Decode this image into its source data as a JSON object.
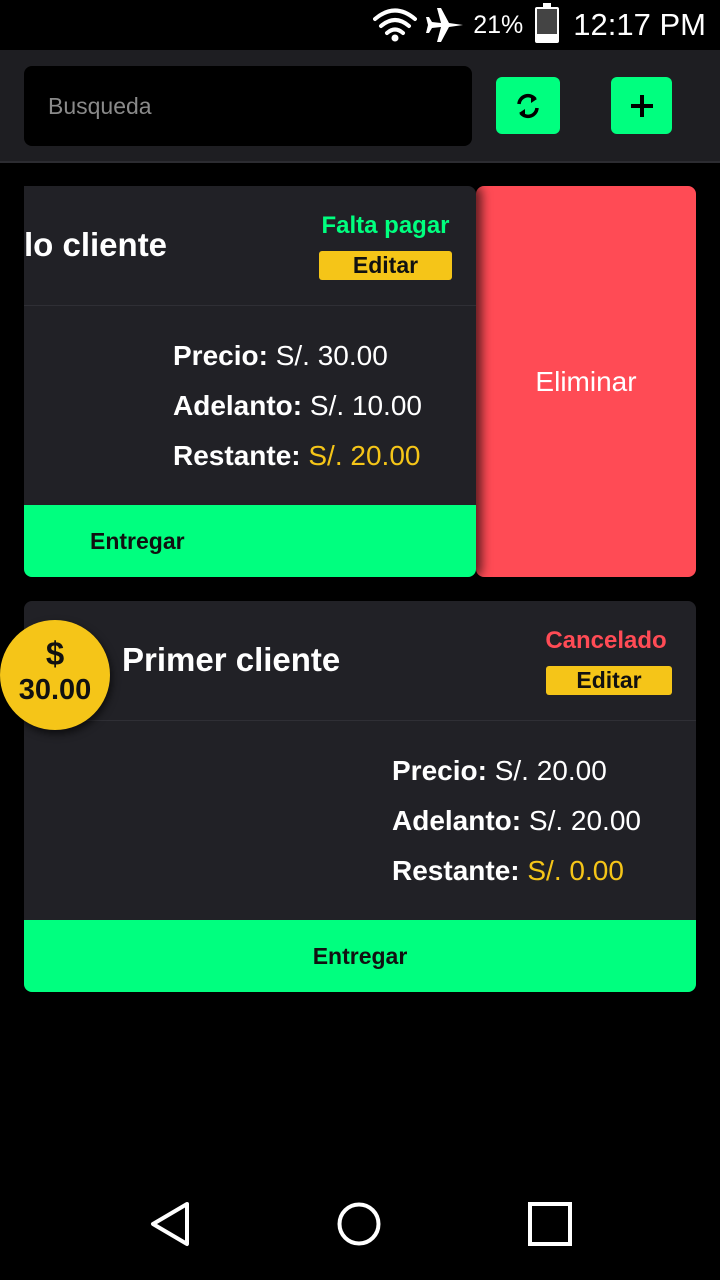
{
  "status_bar": {
    "battery": "21%",
    "battery_level": 0.21,
    "time": "12:17 PM",
    "icons": [
      "wifi-icon",
      "airplane-icon",
      "battery-icon"
    ]
  },
  "toolbar": {
    "search_placeholder": "Busqueda",
    "search_value": "",
    "refresh_icon": "refresh-icon",
    "add_icon": "plus-icon"
  },
  "colors": {
    "accent_green": "#00ff7f",
    "edit_yellow": "#f5c518",
    "delete_red": "#ff4b55",
    "status_pending": "#00ff7f",
    "status_cancelled": "#ff4b55"
  },
  "orders": [
    {
      "client": "lo cliente",
      "status": "Falta pagar",
      "edit_label": "Editar",
      "price_label": "Precio:",
      "price": "S/. 30.00",
      "advance_label": "Adelanto:",
      "advance": "S/. 10.00",
      "remaining_label": "Restante:",
      "remaining": "S/. 20.00",
      "deliver_label": "Entregar",
      "delete_label": "Eliminar"
    },
    {
      "client": "Primer cliente",
      "status": "Cancelado",
      "edit_label": "Editar",
      "badge_symbol": "$",
      "badge_amount": "30.00",
      "price_label": "Precio:",
      "price": "S/. 20.00",
      "advance_label": "Adelanto:",
      "advance": "S/. 20.00",
      "remaining_label": "Restante:",
      "remaining": "S/. 0.00",
      "deliver_label": "Entregar"
    }
  ],
  "nav_bar": {
    "icons": [
      "back-icon",
      "home-icon",
      "recents-icon"
    ]
  }
}
